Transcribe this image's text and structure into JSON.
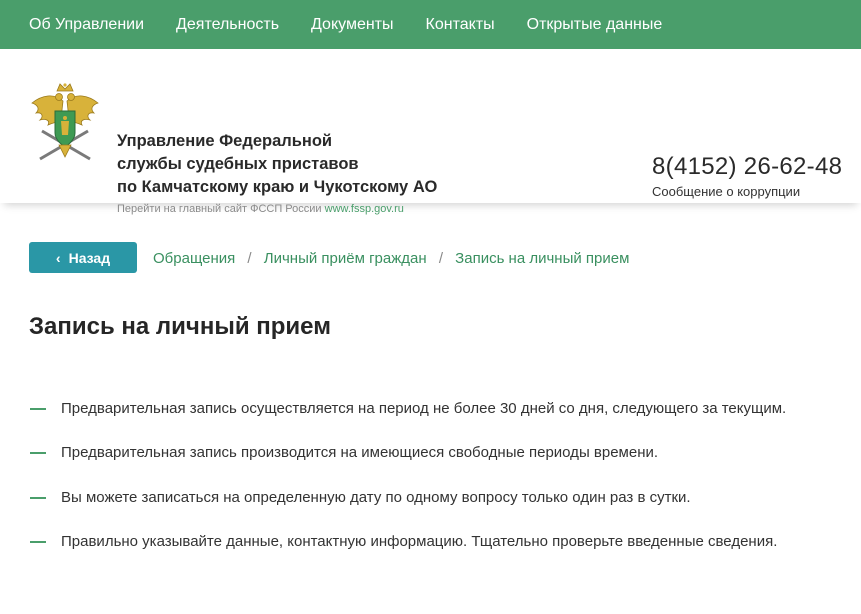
{
  "topnav": {
    "items": [
      "Об Управлении",
      "Деятельность",
      "Документы",
      "Контакты",
      "Открытые данные"
    ]
  },
  "header": {
    "org_lines": [
      "Управление Федеральной",
      "службы судебных приставов",
      "по Камчатскому краю и Чукотскому АО"
    ],
    "main_site_text": "Перейти на главный сайт ФССП России",
    "main_site_link": "www.fssp.gov.ru",
    "phone": "8(4152) 26-62-48",
    "corruption_label": "Сообщение о коррупции"
  },
  "nav": {
    "back_label": "Назад",
    "breadcrumbs": [
      "Обращения",
      "Личный приём граждан",
      "Запись на личный прием"
    ]
  },
  "page": {
    "title": "Запись на личный прием",
    "rules": [
      "Предварительная запись осуществляется на период не более 30 дней со дня, следующего за текущим.",
      "Предварительная запись производится на имеющиеся свободные периоды времени.",
      "Вы можете записаться на определенную дату по одному вопросу только один раз в сутки.",
      "Правильно указывайте данные, контактную информацию. Тщательно проверьте введенные сведения."
    ]
  },
  "colors": {
    "nav_green": "#4a9e6b",
    "back_button": "#2a97a6",
    "link_green": "#3a9060"
  },
  "icons": {
    "emblem": "fssp-emblem-icon",
    "back": "chevron-left-icon",
    "rule_marker": "dash-icon"
  }
}
